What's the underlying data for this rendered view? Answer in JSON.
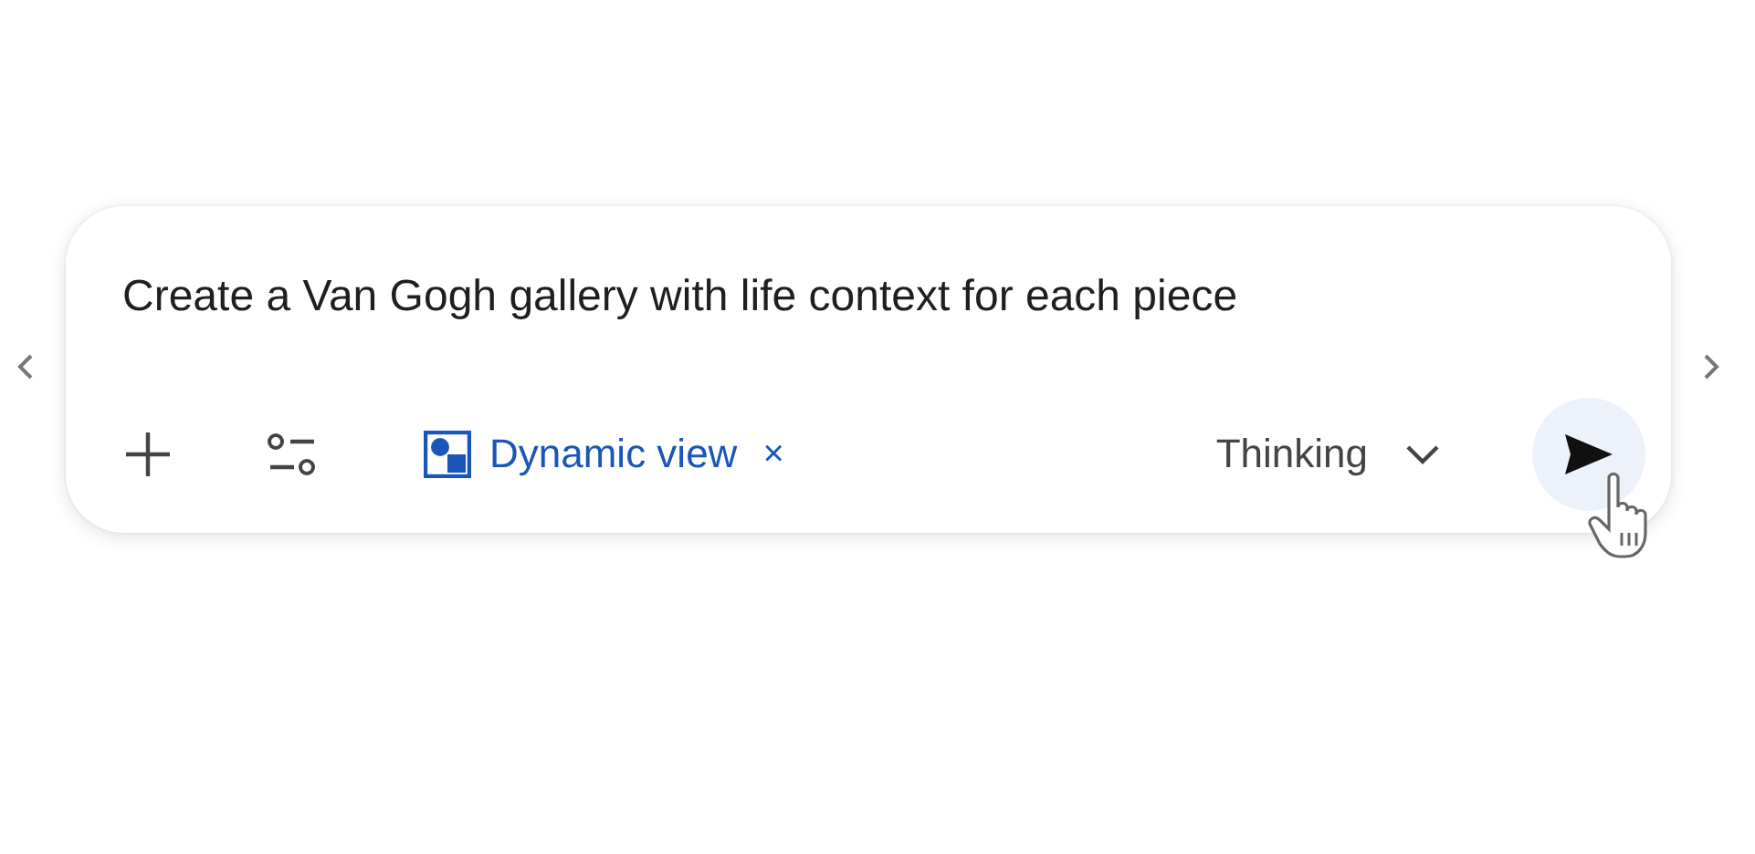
{
  "prompt": {
    "value": "Create a Van Gogh gallery with life context for each piece"
  },
  "tool_chip": {
    "label": "Dynamic view",
    "remove": "×",
    "selected": true
  },
  "model_picker": {
    "label": "Thinking"
  }
}
